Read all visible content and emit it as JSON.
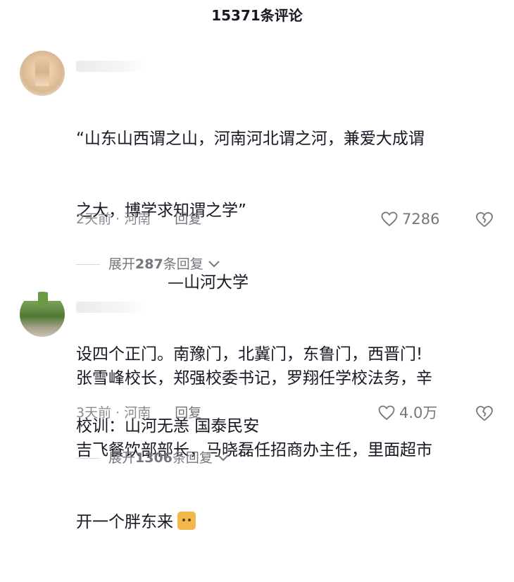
{
  "header": {
    "title": "15371条评论"
  },
  "comments": [
    {
      "lines": [
        "“山东山西谓之山，河南河北谓之河，兼爱大成谓",
        "之大，博学求知谓之学”",
        "—山河大学",
        "设四个正门。南豫门，北冀门，东鲁门，西晋门!",
        "校训：山河无恙 国泰民安"
      ],
      "time_location": "2天前 · 河南",
      "reply_label": "回复",
      "likes": "7286",
      "expand_prefix": "展开",
      "expand_count": "287",
      "expand_suffix": "条回复"
    },
    {
      "lines": [
        "张雪峰校长，郑强校委书记，罗翔任学校法务，辛",
        "吉飞餐饮部部长，马晓磊任招商办主任，里面超市",
        "开一个胖东来"
      ],
      "time_location": "3天前 · 河南",
      "reply_label": "回复",
      "likes": "4.0万",
      "expand_prefix": "展开",
      "expand_count": "1306",
      "expand_suffix": "条回复"
    }
  ],
  "icons": {
    "like": "heart-outline-icon",
    "dislike": "broken-heart-icon",
    "expand": "chevron-down-icon",
    "emoji": "cat-emoji-icon"
  },
  "colors": {
    "text": "#161823",
    "meta": "#8a8b91",
    "accent_grey": "#75767c"
  }
}
